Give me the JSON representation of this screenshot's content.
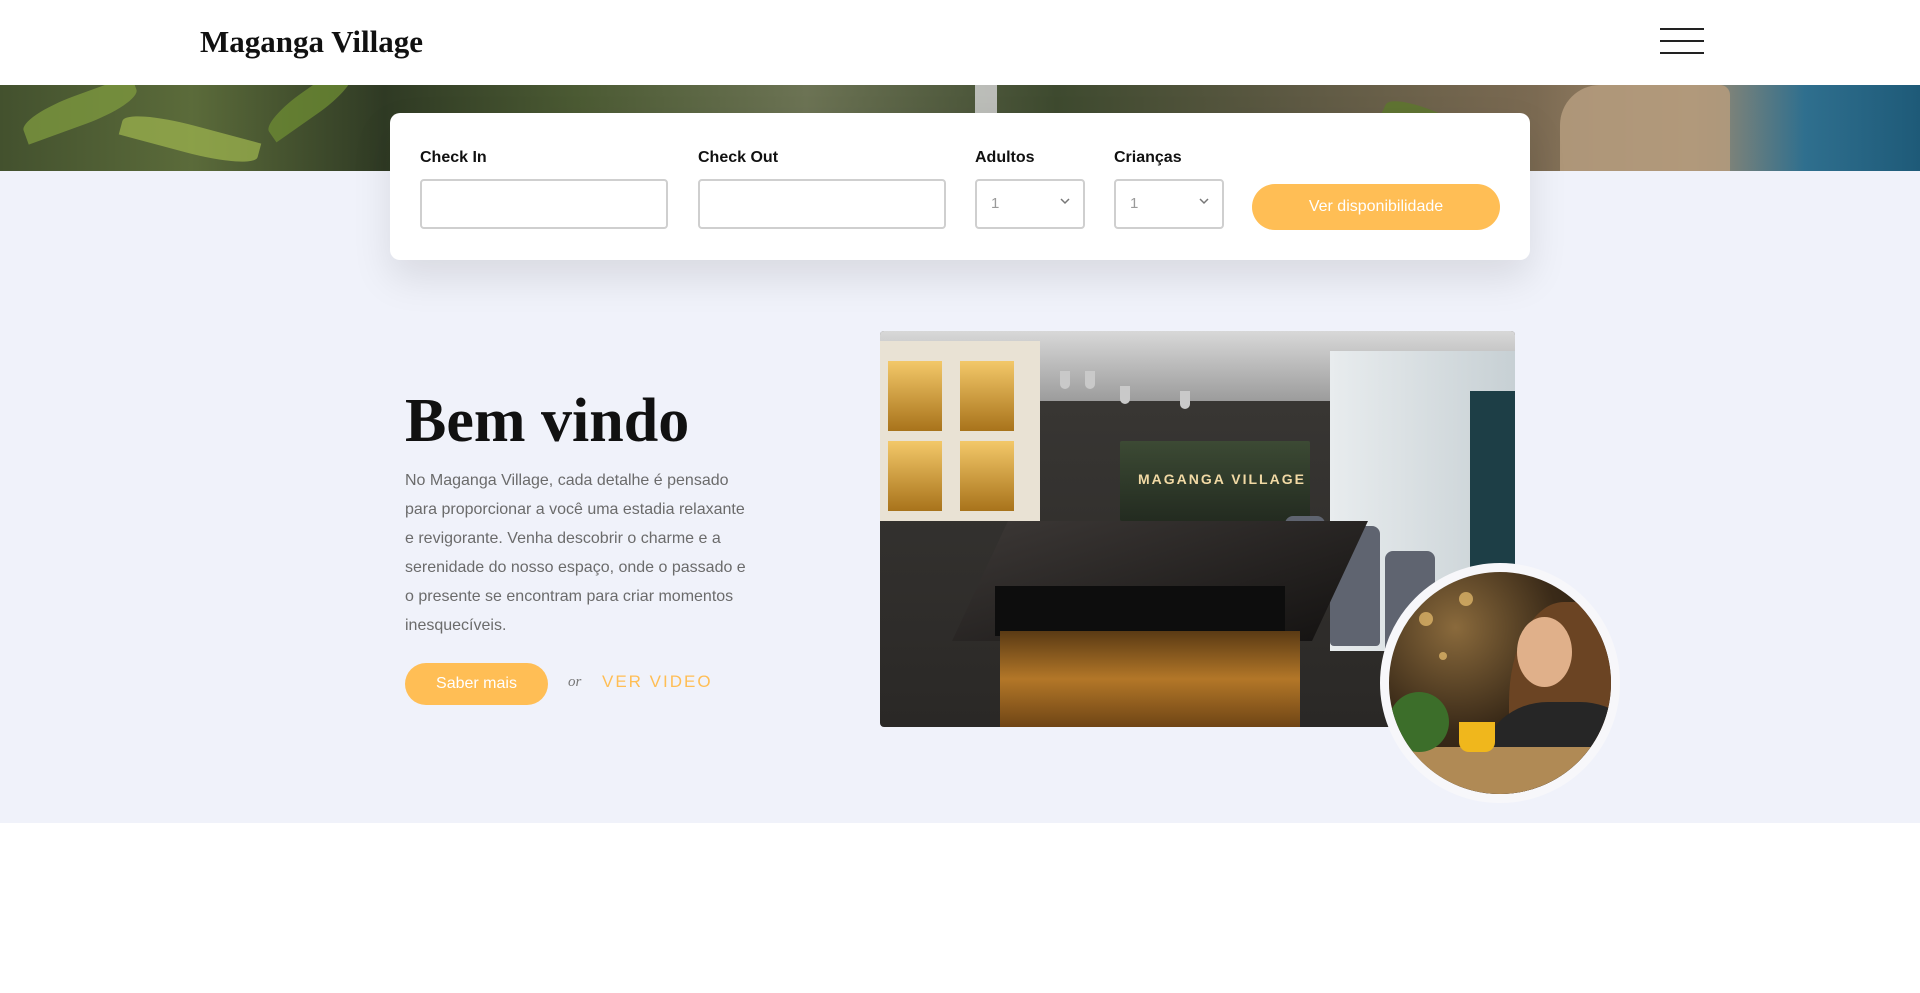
{
  "header": {
    "brand": "Maganga Village",
    "menu_icon": "hamburger-menu-icon"
  },
  "booking": {
    "checkin_label": "Check In",
    "checkin_value": "",
    "checkout_label": "Check Out",
    "checkout_value": "",
    "adultos_label": "Adultos",
    "adultos_value": "1",
    "criancas_label": "Crianças",
    "criancas_value": "1",
    "submit_label": "Ver disponibilidade"
  },
  "welcome": {
    "title": "Bem vindo",
    "text": "No Maganga Village, cada detalhe é pensado para proporcionar a você uma estadia relaxante e revigorante. Venha descobrir o charme e a serenidade do nosso espaço, onde o passado e o presente se encontram para criar momentos inesquecíveis.",
    "button_label": "Saber mais",
    "or_text": "or",
    "video_label": "VER VIDEO"
  },
  "photo": {
    "sign_text": "MAGANGA VILLAGE"
  },
  "colors": {
    "accent": "#ffbe55",
    "section_bg": "#f0f2fa"
  }
}
